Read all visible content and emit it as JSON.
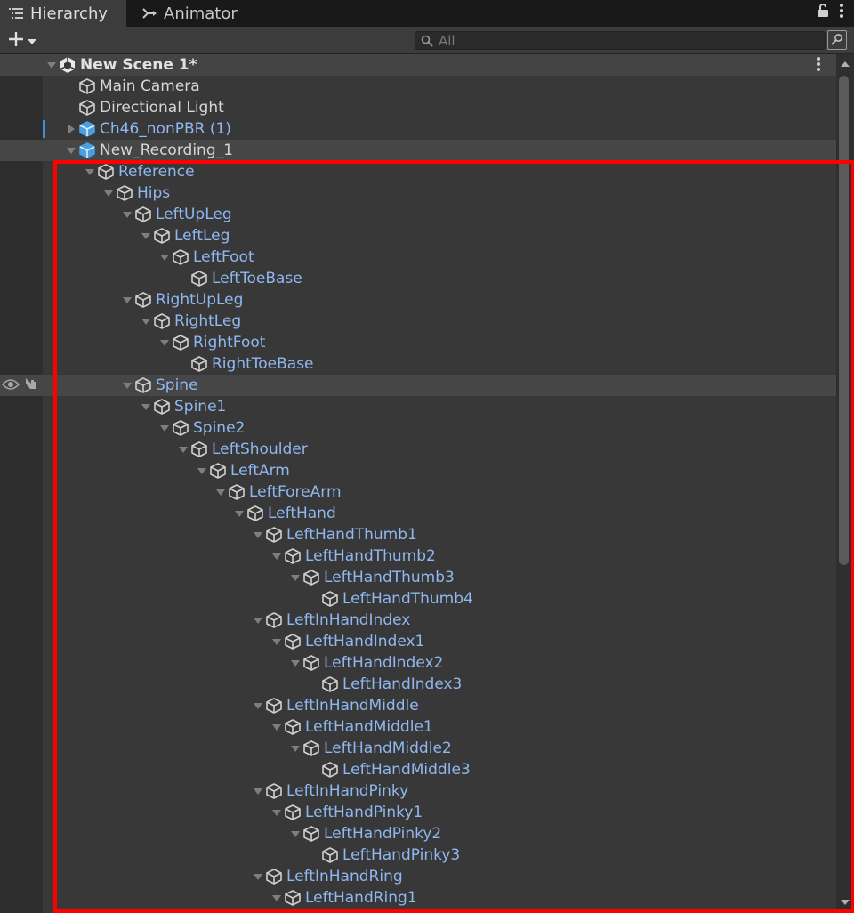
{
  "tabs": [
    {
      "label": "Hierarchy",
      "icon": "list-icon",
      "active": true
    },
    {
      "label": "Animator",
      "icon": "animator-icon",
      "active": false
    }
  ],
  "toolbar": {
    "add_label": "+",
    "search_placeholder": "All"
  },
  "tree": [
    {
      "label": "New Scene 1*",
      "depth": 0,
      "kind": "scene",
      "expanded": true
    },
    {
      "label": "Main Camera",
      "depth": 1,
      "kind": "go"
    },
    {
      "label": "Directional Light",
      "depth": 1,
      "kind": "go"
    },
    {
      "label": "Ch46_nonPBR (1)",
      "depth": 1,
      "kind": "prefab",
      "expanded": false,
      "modified_marker": true
    },
    {
      "label": "New_Recording_1",
      "depth": 1,
      "kind": "prefab-root",
      "expanded": true,
      "selected": true
    },
    {
      "label": "Reference",
      "depth": 2,
      "kind": "bone",
      "expanded": true
    },
    {
      "label": "Hips",
      "depth": 3,
      "kind": "bone",
      "expanded": true
    },
    {
      "label": "LeftUpLeg",
      "depth": 4,
      "kind": "bone",
      "expanded": true
    },
    {
      "label": "LeftLeg",
      "depth": 5,
      "kind": "bone",
      "expanded": true
    },
    {
      "label": "LeftFoot",
      "depth": 6,
      "kind": "bone",
      "expanded": true
    },
    {
      "label": "LeftToeBase",
      "depth": 7,
      "kind": "bone"
    },
    {
      "label": "RightUpLeg",
      "depth": 4,
      "kind": "bone",
      "expanded": true
    },
    {
      "label": "RightLeg",
      "depth": 5,
      "kind": "bone",
      "expanded": true
    },
    {
      "label": "RightFoot",
      "depth": 6,
      "kind": "bone",
      "expanded": true
    },
    {
      "label": "RightToeBase",
      "depth": 7,
      "kind": "bone"
    },
    {
      "label": "Spine",
      "depth": 4,
      "kind": "bone",
      "expanded": true,
      "hovered": true
    },
    {
      "label": "Spine1",
      "depth": 5,
      "kind": "bone",
      "expanded": true
    },
    {
      "label": "Spine2",
      "depth": 6,
      "kind": "bone",
      "expanded": true
    },
    {
      "label": "LeftShoulder",
      "depth": 7,
      "kind": "bone",
      "expanded": true
    },
    {
      "label": "LeftArm",
      "depth": 8,
      "kind": "bone",
      "expanded": true
    },
    {
      "label": "LeftForeArm",
      "depth": 9,
      "kind": "bone",
      "expanded": true
    },
    {
      "label": "LeftHand",
      "depth": 10,
      "kind": "bone",
      "expanded": true
    },
    {
      "label": "LeftHandThumb1",
      "depth": 11,
      "kind": "bone",
      "expanded": true
    },
    {
      "label": "LeftHandThumb2",
      "depth": 12,
      "kind": "bone",
      "expanded": true
    },
    {
      "label": "LeftHandThumb3",
      "depth": 13,
      "kind": "bone",
      "expanded": true
    },
    {
      "label": "LeftHandThumb4",
      "depth": 14,
      "kind": "bone"
    },
    {
      "label": "LeftInHandIndex",
      "depth": 11,
      "kind": "bone",
      "expanded": true
    },
    {
      "label": "LeftHandIndex1",
      "depth": 12,
      "kind": "bone",
      "expanded": true
    },
    {
      "label": "LeftHandIndex2",
      "depth": 13,
      "kind": "bone",
      "expanded": true
    },
    {
      "label": "LeftHandIndex3",
      "depth": 14,
      "kind": "bone"
    },
    {
      "label": "LeftInHandMiddle",
      "depth": 11,
      "kind": "bone",
      "expanded": true
    },
    {
      "label": "LeftHandMiddle1",
      "depth": 12,
      "kind": "bone",
      "expanded": true
    },
    {
      "label": "LeftHandMiddle2",
      "depth": 13,
      "kind": "bone",
      "expanded": true
    },
    {
      "label": "LeftHandMiddle3",
      "depth": 14,
      "kind": "bone"
    },
    {
      "label": "LeftInHandPinky",
      "depth": 11,
      "kind": "bone",
      "expanded": true
    },
    {
      "label": "LeftHandPinky1",
      "depth": 12,
      "kind": "bone",
      "expanded": true
    },
    {
      "label": "LeftHandPinky2",
      "depth": 13,
      "kind": "bone",
      "expanded": true
    },
    {
      "label": "LeftHandPinky3",
      "depth": 14,
      "kind": "bone"
    },
    {
      "label": "LeftInHandRing",
      "depth": 11,
      "kind": "bone",
      "expanded": true
    },
    {
      "label": "LeftHandRing1",
      "depth": 12,
      "kind": "bone",
      "expanded": true
    }
  ],
  "colors": {
    "prefab_label": "#8fb7f0",
    "gameobject_label": "#d6d6d6",
    "prefab_marker": "#3a90d8",
    "highlight": "#ff0000"
  }
}
